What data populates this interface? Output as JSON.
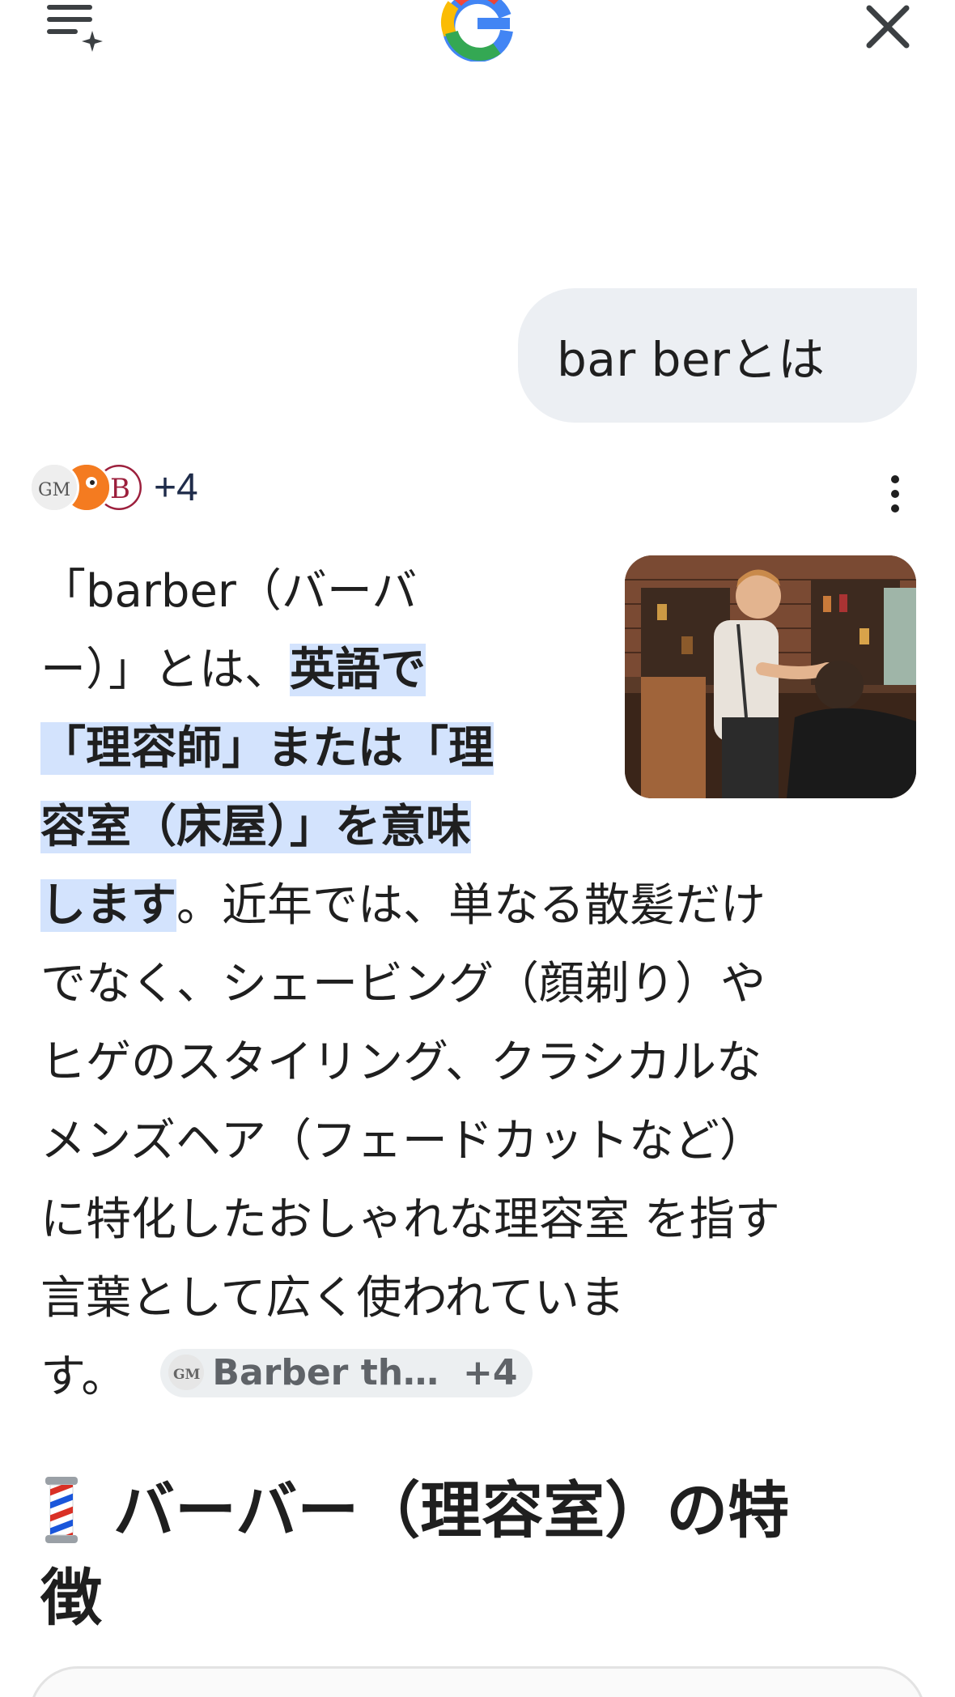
{
  "query": {
    "text": "bar berとは"
  },
  "sources": {
    "count_label": "+4"
  },
  "answer": {
    "lines": [
      {
        "plain": "「barber（バーバ",
        "highlight": ""
      },
      {
        "plain": "ー）」とは、",
        "highlight": "英語で"
      },
      {
        "plain": "",
        "highlight": "「理容師」または「理"
      },
      {
        "plain": "",
        "highlight": "容室（床屋）」を意味"
      },
      {
        "highlight": "します",
        "plain": "。近年では、単なる散髪だけ"
      },
      {
        "plain": "でなく、シェービング（顔剃り）や",
        "highlight": ""
      },
      {
        "plain": "ヒゲのスタイリング、クラシカルな",
        "highlight": ""
      },
      {
        "plain": "メンズヘア（フェードカットなど）",
        "highlight": ""
      },
      {
        "plain": "に特化したおしゃれな理容室 を指す",
        "highlight": ""
      },
      {
        "plain": "言葉として広く使われていま",
        "highlight": ""
      },
      {
        "plain": "す。",
        "highlight": ""
      }
    ],
    "citation": {
      "label": "Barber th…",
      "count": "+4"
    }
  },
  "section": {
    "heading_line1": "バーバー（理容室）の特",
    "heading_line2": "徴",
    "icon": "barber-pole-icon"
  },
  "colors": {
    "highlight": "#d3e3fd",
    "bubble": "#eceff3",
    "text": "#1f1f1f"
  }
}
